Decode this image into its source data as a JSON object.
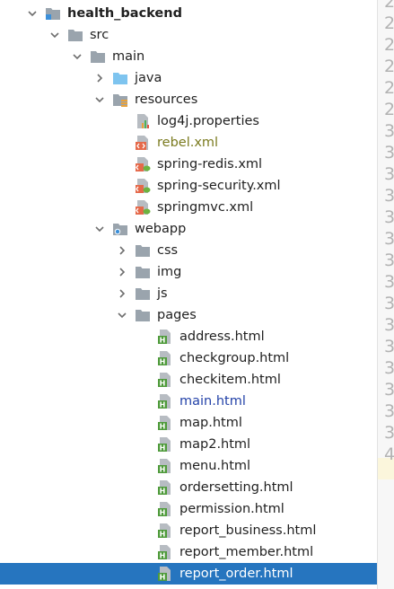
{
  "project_tree": [
    {
      "label": "health_backend",
      "icon": "module-folder-icon",
      "expanded": true,
      "depth": 0,
      "bold": true
    },
    {
      "label": "src",
      "icon": "folder-icon",
      "expanded": true,
      "depth": 1
    },
    {
      "label": "main",
      "icon": "folder-icon",
      "expanded": true,
      "depth": 2
    },
    {
      "label": "java",
      "icon": "source-folder-icon",
      "expanded": false,
      "depth": 3
    },
    {
      "label": "resources",
      "icon": "resources-folder-icon",
      "expanded": true,
      "depth": 3
    },
    {
      "label": "log4j.properties",
      "icon": "properties-file-icon",
      "depth": 4
    },
    {
      "label": "rebel.xml",
      "icon": "xml-file-icon",
      "depth": 4,
      "style": "olive"
    },
    {
      "label": "spring-redis.xml",
      "icon": "spring-xml-file-icon",
      "depth": 4
    },
    {
      "label": "spring-security.xml",
      "icon": "spring-xml-file-icon",
      "depth": 4
    },
    {
      "label": "springmvc.xml",
      "icon": "spring-xml-file-icon",
      "depth": 4
    },
    {
      "label": "webapp",
      "icon": "web-folder-icon",
      "expanded": true,
      "depth": 3
    },
    {
      "label": "css",
      "icon": "folder-icon",
      "expanded": false,
      "depth": 4
    },
    {
      "label": "img",
      "icon": "folder-icon",
      "expanded": false,
      "depth": 4
    },
    {
      "label": "js",
      "icon": "folder-icon",
      "expanded": false,
      "depth": 4
    },
    {
      "label": "pages",
      "icon": "folder-icon",
      "expanded": true,
      "depth": 4
    },
    {
      "label": "address.html",
      "icon": "html-file-icon",
      "depth": 5
    },
    {
      "label": "checkgroup.html",
      "icon": "html-file-icon",
      "depth": 5
    },
    {
      "label": "checkitem.html",
      "icon": "html-file-icon",
      "depth": 5
    },
    {
      "label": "main.html",
      "icon": "html-file-icon",
      "depth": 5,
      "style": "blue"
    },
    {
      "label": "map.html",
      "icon": "html-file-icon",
      "depth": 5
    },
    {
      "label": "map2.html",
      "icon": "html-file-icon",
      "depth": 5
    },
    {
      "label": "menu.html",
      "icon": "html-file-icon",
      "depth": 5
    },
    {
      "label": "ordersetting.html",
      "icon": "html-file-icon",
      "depth": 5
    },
    {
      "label": "permission.html",
      "icon": "html-file-icon",
      "depth": 5
    },
    {
      "label": "report_business.html",
      "icon": "html-file-icon",
      "depth": 5
    },
    {
      "label": "report_member.html",
      "icon": "html-file-icon",
      "depth": 5
    },
    {
      "label": "report_order.html",
      "icon": "html-file-icon",
      "depth": 5,
      "selected": true
    }
  ],
  "gutter_numbers": [
    "2",
    "2",
    "2",
    "2",
    "2",
    "2",
    "3",
    "3",
    "3",
    "3",
    "3",
    "3",
    "3",
    "3",
    "3",
    "3",
    "3",
    "3",
    "3",
    "3",
    "3",
    "4"
  ]
}
